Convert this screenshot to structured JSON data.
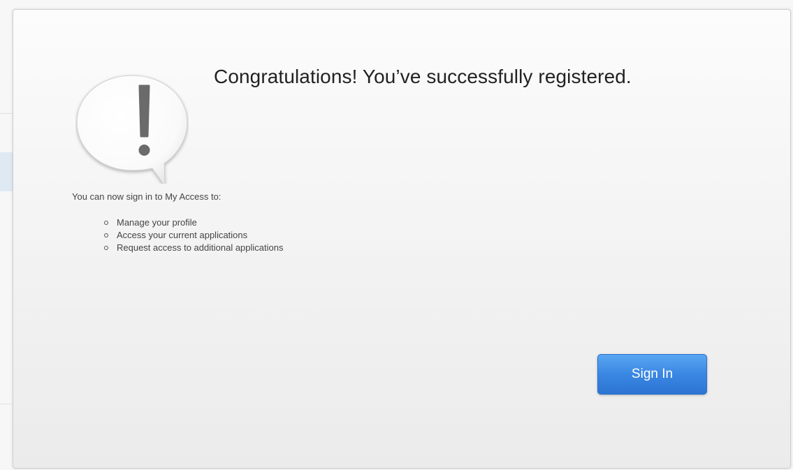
{
  "dialog": {
    "title": "Congratulations! You’ve successfully registered.",
    "intro": "You can now sign in to My Access to:",
    "benefits": [
      "Manage your profile",
      "Access your current applications",
      "Request access to additional applications"
    ],
    "sign_in_label": "Sign In",
    "icon": "exclamation-speech-bubble-icon"
  },
  "colors": {
    "primary_button": "#3a87e3",
    "title_text": "#222222",
    "body_text": "#444444",
    "exclamation_mark": "#6b6b6b"
  }
}
